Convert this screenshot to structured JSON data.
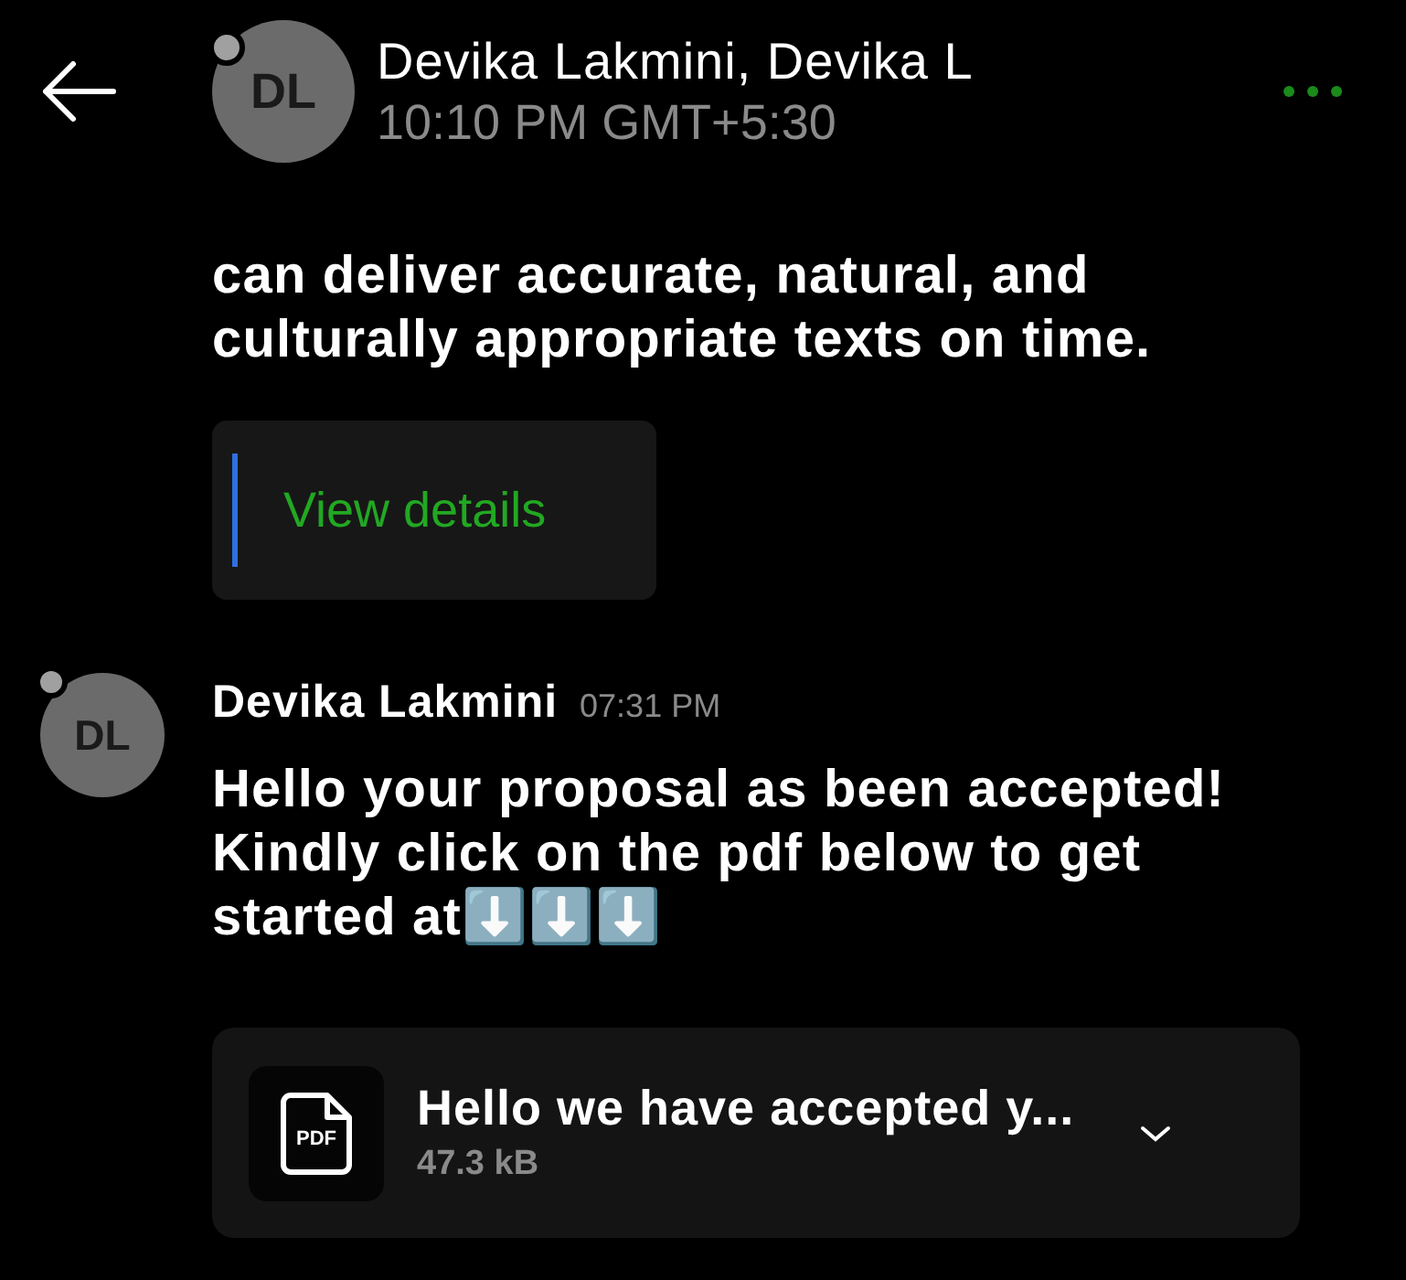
{
  "header": {
    "avatar": "DL",
    "title": "Devika Lakmini, Devika L",
    "subtitle": "10:10 PM GMT+5:30"
  },
  "messages": [
    {
      "kind": "continuation",
      "text": "can deliver accurate, natural, and culturally appropriate texts on time.",
      "link_card": {
        "label": "View details"
      }
    },
    {
      "kind": "message",
      "avatar": "DL",
      "sender": "Devika Lakmini",
      "time": "07:31 PM",
      "text": "Hello your proposal as been accepted! Kindly click on the pdf below to get started at⬇️⬇️⬇️",
      "attachment": {
        "icon_label": "PDF",
        "name": "Hello we have accepted y...",
        "size": "47.3 kB"
      }
    }
  ]
}
